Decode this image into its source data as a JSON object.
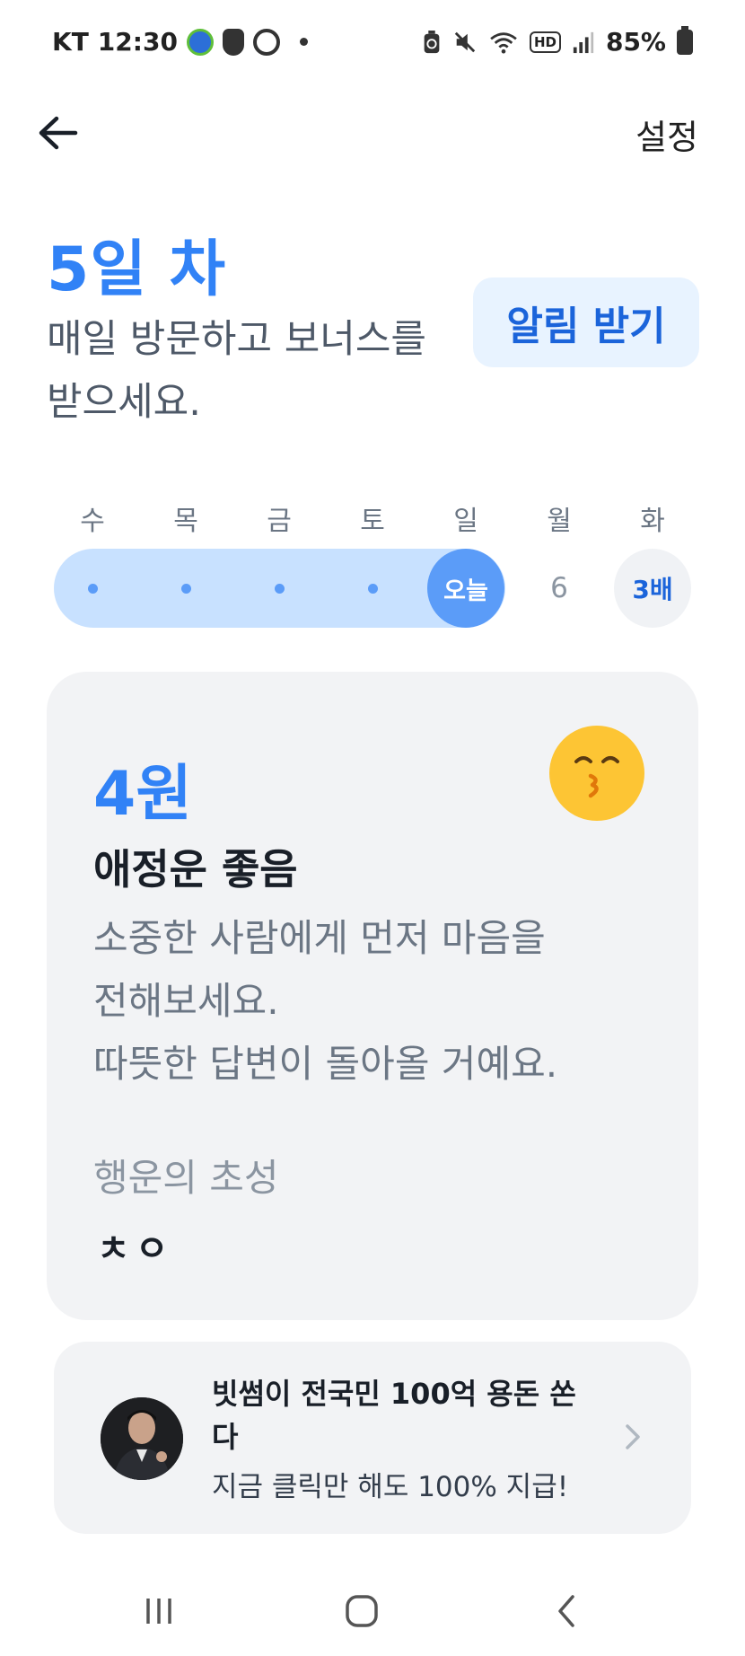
{
  "status_bar": {
    "carrier": "KT",
    "time": "12:30",
    "battery": "85%",
    "hd_label": "HD"
  },
  "app_bar": {
    "settings_label": "설정"
  },
  "header": {
    "day_title": "5일 차",
    "description": "매일 방문하고 보너스를 받으세요.",
    "notify_button": "알림 받기"
  },
  "week": {
    "labels": [
      "수",
      "목",
      "금",
      "토",
      "일",
      "월",
      "화"
    ],
    "today_label": "오늘",
    "next_day_number": "6",
    "bonus_label": "3배",
    "completed_days": 4
  },
  "fortune": {
    "amount": "4원",
    "title": "애정운 좋음",
    "lines": [
      "소중한 사람에게 먼저 마음을",
      "전해보세요.",
      "따뜻한 답변이 돌아올 거예요."
    ],
    "lucky_label": "행운의 초성",
    "lucky_initials": "ㅊㅇ",
    "emoji_icon": "kissing-face-icon"
  },
  "ad": {
    "title": "빗썸이 전국민 100억 용돈 쏜다",
    "subtitle": "지금 클릭만 해도 100% 지급!"
  },
  "colors": {
    "accent": "#3182f6",
    "accent_light": "#c8e1ff",
    "card_bg": "#f2f3f5",
    "emoji_yellow": "#fdc534"
  }
}
